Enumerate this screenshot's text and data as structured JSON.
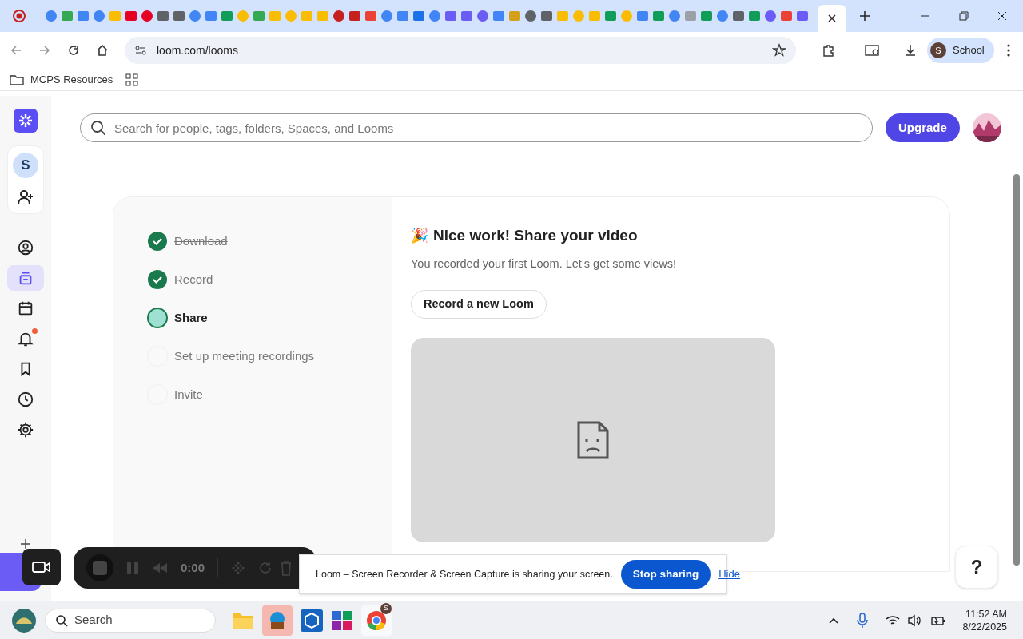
{
  "browser": {
    "address": "loom.com/looms",
    "profile": "School",
    "profile_initial": "S",
    "bookmarks": [
      {
        "label": "MCPS Resources"
      }
    ]
  },
  "sidebar": {
    "workspace_initial": "S",
    "items": [
      {
        "kind": "person",
        "selected": false
      },
      {
        "kind": "library",
        "selected": true
      },
      {
        "kind": "calendar",
        "selected": false
      },
      {
        "kind": "bell",
        "selected": false,
        "badge": true
      },
      {
        "kind": "bookmark",
        "selected": false
      },
      {
        "kind": "clock",
        "selected": false
      },
      {
        "kind": "gear",
        "selected": false
      }
    ]
  },
  "search": {
    "placeholder": "Search for people, tags, folders, Spaces, and Looms"
  },
  "upgrade_button": "Upgrade",
  "steps": [
    {
      "label": "Download",
      "completed": true,
      "selected": false
    },
    {
      "label": "Record",
      "completed": true,
      "selected": false
    },
    {
      "label": "Share",
      "completed": false,
      "selected": true
    },
    {
      "label": "Set up meeting recordings",
      "completed": false,
      "selected": false
    },
    {
      "label": "Invite",
      "completed": false,
      "selected": false
    }
  ],
  "panel": {
    "emoji": "🎉",
    "title": "Nice work! Share your video",
    "subtitle": "You recorded your first Loom. Let’s get some views!",
    "button": "Record a new Loom"
  },
  "recorder": {
    "time": "0:00"
  },
  "sharing_banner": {
    "message": "Loom – Screen Recorder & Screen Capture is sharing your screen.",
    "stop": "Stop sharing",
    "hide": "Hide"
  },
  "help_button": "?",
  "taskbar": {
    "search": "Search",
    "time": "11:52 AM",
    "date": "8/22/2025",
    "chrome_badge": "S"
  }
}
